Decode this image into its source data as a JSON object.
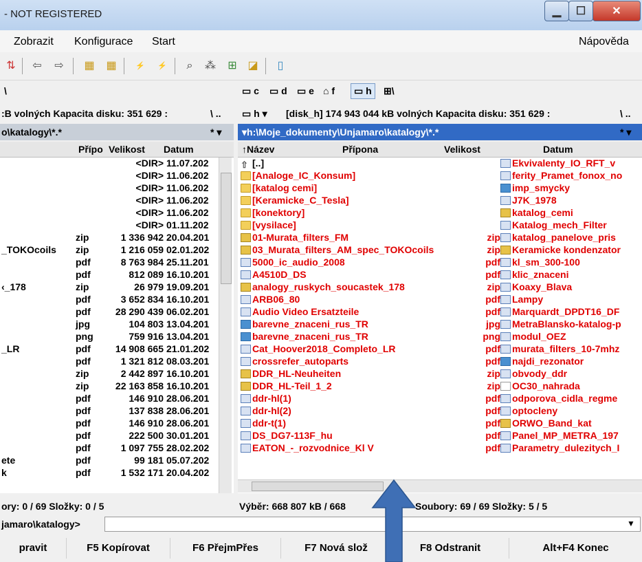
{
  "window": {
    "title": "- NOT REGISTERED"
  },
  "menu": {
    "items": [
      "Zobrazit",
      "Konfigurace",
      "Start"
    ],
    "help": "Nápověda"
  },
  "drives_left": "\\",
  "drives_right": {
    "c": "c",
    "d": "d",
    "e": "e",
    "f": "f",
    "h": "h",
    "net": "\\"
  },
  "left": {
    "disk_info": ":B volných  Kapacita disku: 351 629 :",
    "path": "o\\katalogy\\*.*",
    "filter": "*",
    "headers": {
      "ext": "Přípo",
      "size": "Velikost",
      "date": "Datum"
    },
    "rows": [
      {
        "name": "",
        "ext": "",
        "size": "<DIR>",
        "date": "11.07.202"
      },
      {
        "name": "",
        "ext": "",
        "size": "<DIR>",
        "date": "11.06.202"
      },
      {
        "name": "",
        "ext": "",
        "size": "<DIR>",
        "date": "11.06.202"
      },
      {
        "name": "",
        "ext": "",
        "size": "<DIR>",
        "date": "11.06.202"
      },
      {
        "name": "",
        "ext": "",
        "size": "<DIR>",
        "date": "11.06.202"
      },
      {
        "name": "",
        "ext": "",
        "size": "<DIR>",
        "date": "01.11.202"
      },
      {
        "name": "",
        "ext": "zip",
        "size": "1 336 942",
        "date": "20.04.201"
      },
      {
        "name": "_TOKOcoils",
        "ext": "zip",
        "size": "1 216 059",
        "date": "02.01.202"
      },
      {
        "name": "",
        "ext": "pdf",
        "size": "8 763 984",
        "date": "25.11.201"
      },
      {
        "name": "",
        "ext": "pdf",
        "size": "812 089",
        "date": "16.10.201"
      },
      {
        "name": "‹_178",
        "ext": "zip",
        "size": "26 979",
        "date": "19.09.201"
      },
      {
        "name": "",
        "ext": "pdf",
        "size": "3 652 834",
        "date": "16.10.201"
      },
      {
        "name": "",
        "ext": "pdf",
        "size": "28 290 439",
        "date": "06.02.201"
      },
      {
        "name": "",
        "ext": "jpg",
        "size": "104 803",
        "date": "13.04.201"
      },
      {
        "name": "",
        "ext": "png",
        "size": "759 916",
        "date": "13.04.201"
      },
      {
        "name": "_LR",
        "ext": "pdf",
        "size": "14 908 665",
        "date": "21.01.202"
      },
      {
        "name": "",
        "ext": "pdf",
        "size": "1 321 812",
        "date": "08.03.201"
      },
      {
        "name": "",
        "ext": "zip",
        "size": "2 442 897",
        "date": "16.10.201"
      },
      {
        "name": "",
        "ext": "zip",
        "size": "22 163 858",
        "date": "16.10.201"
      },
      {
        "name": "",
        "ext": "pdf",
        "size": "146 910",
        "date": "28.06.201"
      },
      {
        "name": "",
        "ext": "pdf",
        "size": "137 838",
        "date": "28.06.201"
      },
      {
        "name": "",
        "ext": "pdf",
        "size": "146 910",
        "date": "28.06.201"
      },
      {
        "name": "",
        "ext": "pdf",
        "size": "222 500",
        "date": "30.01.201"
      },
      {
        "name": "",
        "ext": "pdf",
        "size": "1 097 755",
        "date": "28.02.202"
      },
      {
        "name": "ete",
        "ext": "pdf",
        "size": "99 181",
        "date": "05.07.202"
      },
      {
        "name": "k",
        "ext": "pdf",
        "size": "1 532 171",
        "date": "20.04.202"
      }
    ],
    "status": "ory: 0 / 69  Složky: 0 / 5"
  },
  "right": {
    "drive": "h",
    "disk_info": "[disk_h]  174 943 044 kB volných  Kapacita disku: 351 629 :",
    "path": "▾h:\\Moje_dokumenty\\Unjamaro\\katalogy\\*.*",
    "filter": "*",
    "headers": {
      "name": "↑Název",
      "ext": "Přípona",
      "size": "Velikost",
      "date": "Datum"
    },
    "col1": [
      {
        "name": "[..]",
        "ext": "",
        "icon": "up",
        "red": false
      },
      {
        "name": "[Analoge_IC_Konsum]",
        "ext": "",
        "icon": "folder",
        "red": true
      },
      {
        "name": "[katalog cemi]",
        "ext": "",
        "icon": "folder",
        "red": true
      },
      {
        "name": "[Keramicke_C_Tesla]",
        "ext": "",
        "icon": "folder",
        "red": true
      },
      {
        "name": "[konektory]",
        "ext": "",
        "icon": "folder",
        "red": true
      },
      {
        "name": "[vysilace]",
        "ext": "",
        "icon": "folder",
        "red": true
      },
      {
        "name": "01-Murata_filters_FM",
        "ext": "zip",
        "icon": "zip",
        "red": true
      },
      {
        "name": "03_Murata_filters_AM_spec_TOKOcoils",
        "ext": "zip",
        "icon": "zip",
        "red": true
      },
      {
        "name": "5000_ic_audio_2008",
        "ext": "pdf",
        "icon": "pdf",
        "red": true
      },
      {
        "name": "A4510D_DS",
        "ext": "pdf",
        "icon": "pdf",
        "red": true
      },
      {
        "name": "analogy_ruskych_soucastek_178",
        "ext": "zip",
        "icon": "zip",
        "red": true
      },
      {
        "name": "ARB06_80",
        "ext": "pdf",
        "icon": "pdf",
        "red": true
      },
      {
        "name": "Audio Video Ersatzteile",
        "ext": "pdf",
        "icon": "pdf",
        "red": true
      },
      {
        "name": "barevne_znaceni_rus_TR",
        "ext": "jpg",
        "icon": "img",
        "red": true
      },
      {
        "name": "barevne_znaceni_rus_TR",
        "ext": "png",
        "icon": "img",
        "red": true
      },
      {
        "name": "Cat_Hoover2018_Completo_LR",
        "ext": "pdf",
        "icon": "pdf",
        "red": true
      },
      {
        "name": "crossrefer_autoparts",
        "ext": "pdf",
        "icon": "pdf",
        "red": true
      },
      {
        "name": "DDR_HL-Neuheiten",
        "ext": "zip",
        "icon": "zip",
        "red": true
      },
      {
        "name": "DDR_HL-Teil_1_2",
        "ext": "zip",
        "icon": "zip",
        "red": true
      },
      {
        "name": "ddr-hl(1)",
        "ext": "pdf",
        "icon": "pdf",
        "red": true
      },
      {
        "name": "ddr-hl(2)",
        "ext": "pdf",
        "icon": "pdf",
        "red": true
      },
      {
        "name": "ddr-t(1)",
        "ext": "pdf",
        "icon": "pdf",
        "red": true
      },
      {
        "name": "DS_DG7-113F_hu",
        "ext": "pdf",
        "icon": "pdf",
        "red": true
      },
      {
        "name": "EATON_-_rozvodnice_Kl V",
        "ext": "pdf",
        "icon": "pdf",
        "red": true
      }
    ],
    "col2": [
      {
        "name": "Ekvivalenty_IO_RFT_v",
        "icon": "pdf"
      },
      {
        "name": "ferity_Pramet_fonox_no",
        "icon": "pdf"
      },
      {
        "name": "imp_smycky",
        "icon": "img"
      },
      {
        "name": "J7K_1978",
        "icon": "pdf"
      },
      {
        "name": "katalog_cemi",
        "icon": "zip"
      },
      {
        "name": "Katalog_mech_Filter",
        "icon": "pdf"
      },
      {
        "name": "katalog_panelove_pris",
        "icon": "pdf"
      },
      {
        "name": "Keramicke kondenzator",
        "icon": "zip"
      },
      {
        "name": "kl_sm_300-100",
        "icon": "pdf"
      },
      {
        "name": "klic_znaceni",
        "icon": "pdf"
      },
      {
        "name": "Koaxy_Blava",
        "icon": "pdf"
      },
      {
        "name": "Lampy",
        "icon": "pdf"
      },
      {
        "name": "Marquardt_DPDT16_DF",
        "icon": "pdf"
      },
      {
        "name": "MetraBlansko-katalog-p",
        "icon": "pdf"
      },
      {
        "name": "modul_OEZ",
        "icon": "pdf"
      },
      {
        "name": "murata_filters_10-7mhz",
        "icon": "pdf"
      },
      {
        "name": "najdi_rezonator",
        "icon": "img"
      },
      {
        "name": "obvody_ddr",
        "icon": "pdf"
      },
      {
        "name": "OC30_nahrada",
        "icon": "doc"
      },
      {
        "name": "odporova_cidla_regme",
        "icon": "pdf"
      },
      {
        "name": "optocleny",
        "icon": "pdf"
      },
      {
        "name": "ORWO_Band_kat",
        "icon": "zip"
      },
      {
        "name": "Panel_MP_METRA_197",
        "icon": "pdf"
      },
      {
        "name": "Parametry_dulezitych_I",
        "icon": "pdf"
      }
    ],
    "status_sel": "Výběr: 668 807 kB / 668",
    "status_files": "Soubory: 69 / 69  Složky: 5 / 5"
  },
  "cmdline": {
    "prefix": "jamaro\\katalogy>"
  },
  "fkeys": [
    "pravit",
    "F5 Kopírovat",
    "F6 PřejmPřes",
    "F7 Nová slož",
    "F8 Odstranit",
    "Alt+F4 Konec"
  ],
  "colors": {
    "accent": "#316ac5",
    "file_red": "#e00000",
    "arrow": "#3f6fb5"
  }
}
